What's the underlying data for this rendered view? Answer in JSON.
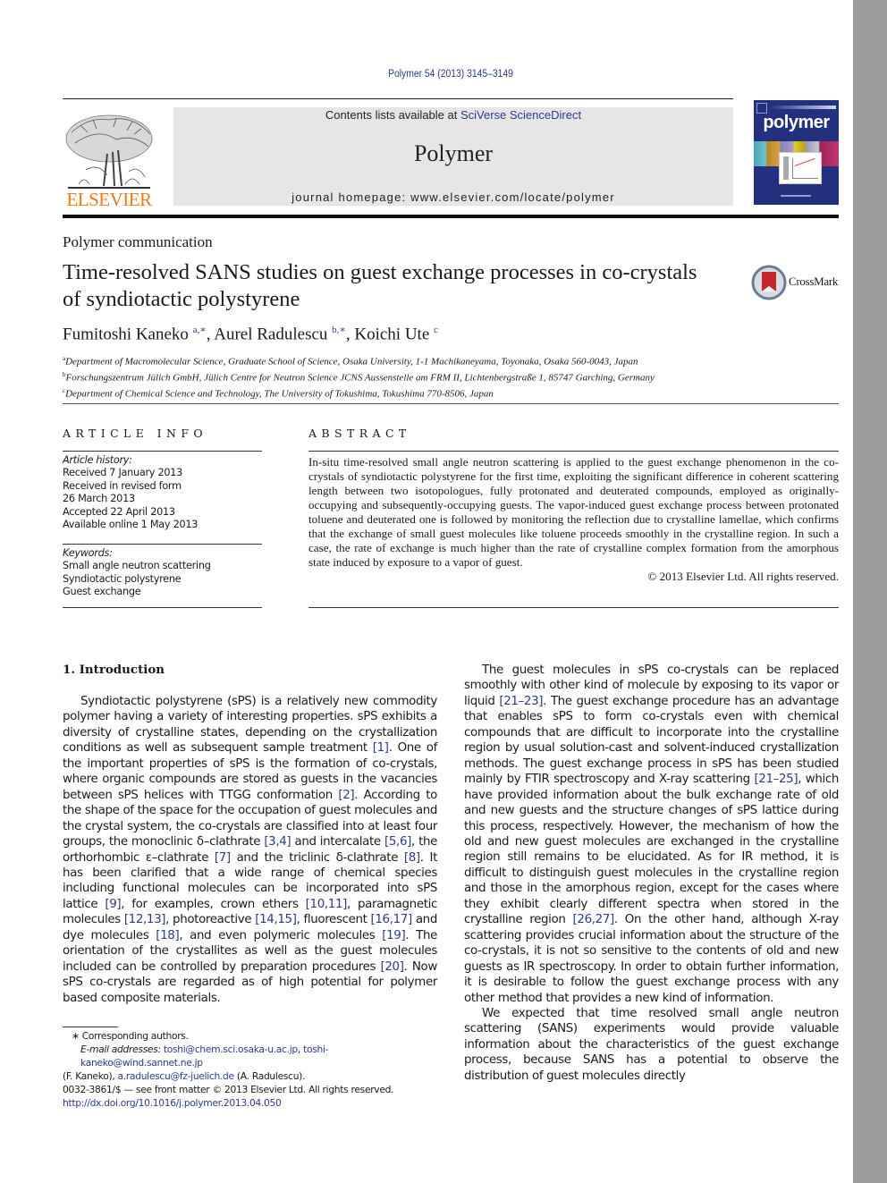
{
  "header": {
    "journal_ref": "Polymer 54 (2013) 3145–3149",
    "contents_prefix": "Contents lists available at ",
    "contents_link": "SciVerse ScienceDirect",
    "journal_name": "Polymer",
    "homepage": "journal homepage: www.elsevier.com/locate/polymer",
    "publisher_logo_text": "ELSEVIER",
    "cover_title": "polymer"
  },
  "article": {
    "type": "Polymer communication",
    "title": "Time-resolved SANS studies on guest exchange processes in co-crystals of syndiotactic polystyrene",
    "crossmark_label": "CrossMark",
    "authors": [
      {
        "name": "Fumitoshi Kaneko",
        "sup": "a,∗"
      },
      {
        "name": "Aurel Radulescu",
        "sup": "b,∗"
      },
      {
        "name": "Koichi Ute",
        "sup": "c"
      }
    ],
    "affiliations": [
      {
        "key": "a",
        "text": "Department of Macromolecular Science, Graduate School of Science, Osaka University, 1-1 Machikaneyama, Toyonaka, Osaka 560-0043, Japan"
      },
      {
        "key": "b",
        "text": "Forschungszentrum Jülich GmbH, Jülich Centre for Neutron Science JCNS Aussenstelle am FRM II, Lichtenbergstraße 1, 85747 Garching, Germany"
      },
      {
        "key": "c",
        "text": "Department of Chemical Science and Technology, The University of Tokushima, Tokushima 770-8506, Japan"
      }
    ]
  },
  "article_info": {
    "heading": "ARTICLE INFO",
    "history_label": "Article history:",
    "history": [
      "Received 7 January 2013",
      "Received in revised form",
      "26 March 2013",
      "Accepted 22 April 2013",
      "Available online 1 May 2013"
    ],
    "keywords_label": "Keywords:",
    "keywords": [
      "Small angle neutron scattering",
      "Syndiotactic polystyrene",
      "Guest exchange"
    ]
  },
  "abstract": {
    "heading": "ABSTRACT",
    "text": "In-situ time-resolved small angle neutron scattering is applied to the guest exchange phenomenon in the co-crystals of syndiotactic polystyrene for the first time, exploiting the significant difference in coherent scattering length between two isotopologues, fully protonated and deuterated compounds, employed as originally-occupying and subsequently-occupying guests. The vapor-induced guest exchange process between protonated toluene and deuterated one is followed by monitoring the reflection due to crys­talline lamellae, which confirms that the exchange of small guest molecules like toluene proceeds smoothly in the crystalline region. In such a case, the rate of exchange is much higher than the rate of crystalline complex formation from the amorphous state induced by exposure to a vapor of guest.",
    "copyright": "© 2013 Elsevier Ltd. All rights reserved."
  },
  "body": {
    "section_heading": "1.  Introduction",
    "left_paragraph": [
      {
        "t": "Syndiotactic polystyrene (sPS) is a relatively new commodity polymer having a variety of interesting properties. sPS exhibits a diversity of crystalline states, depending on the crystallization conditions as well as subsequent sample treatment "
      },
      {
        "ref": "[1]"
      },
      {
        "t": ". One of the important properties of sPS is the formation of co-crystals, where organic compounds are stored as guests in the vacancies between sPS helices with TTGG conformation "
      },
      {
        "ref": "[2]"
      },
      {
        "t": ". According to the shape of the space for the occupation of guest molecules and the crystal system, the co-crystals are classified into at least four groups, the monoclinic δ–clathrate "
      },
      {
        "ref": "[3,4]"
      },
      {
        "t": " and intercalate "
      },
      {
        "ref": "[5,6]"
      },
      {
        "t": ", the ortho­rhombic ε–clathrate "
      },
      {
        "ref": "[7]"
      },
      {
        "t": " and the triclinic δ-clathrate "
      },
      {
        "ref": "[8]"
      },
      {
        "t": ". It has been clarified that a wide range of chemical species including functional molecules can be incorporated into sPS lattice "
      },
      {
        "ref": "[9]"
      },
      {
        "t": ", for examples, crown ethers "
      },
      {
        "ref": "[10,11]"
      },
      {
        "t": ", paramagnetic molecules "
      },
      {
        "ref": "[12,13]"
      },
      {
        "t": ", photo­reactive "
      },
      {
        "ref": "[14,15]"
      },
      {
        "t": ", fluorescent "
      },
      {
        "ref": "[16,17]"
      },
      {
        "t": " and dye molecules "
      },
      {
        "ref": "[18]"
      },
      {
        "t": ", and even polymeric molecules "
      },
      {
        "ref": "[19]"
      },
      {
        "t": ". The orientation of the crystallites as well as the guest molecules included can be controlled by prepa­ration procedures "
      },
      {
        "ref": "[20]"
      },
      {
        "t": ". Now sPS co-crystals are regarded as of high potential for polymer based composite materials."
      }
    ],
    "right_paragraph_1": [
      {
        "t": "The guest molecules in sPS co-crystals can be replaced smoothly with other kind of molecule by exposing to its vapor or liquid "
      },
      {
        "ref": "[21–23]"
      },
      {
        "t": ". The guest exchange procedure has an advantage that enables sPS to form co-crystals even with chemical compounds that are difficult to incorporate into the crystalline region by usual solution-cast and solvent-induced crystallization methods. The guest ex­change process in sPS has been studied mainly by FTIR spectros­copy and X-ray scattering "
      },
      {
        "ref": "[21–25]"
      },
      {
        "t": ", which have provided information about the bulk exchange rate of old and new guests and the structure changes of sPS lattice during this process, respectively. However, the mechanism of how the old and new guest molecules are exchanged in the crystalline region still re­mains to be elucidated. As for IR method, it is difficult to distinguish guest molecules in the crystalline region and those in the amor­phous region, except for the cases where they exhibit clearly different spectra when stored in the crystalline region "
      },
      {
        "ref": "[26,27]"
      },
      {
        "t": ". On the other hand, although X-ray scattering provides crucial infor­mation about the structure of the co-crystals, it is not so sensitive to the contents of old and new guests as IR spectroscopy. In order to obtain further information, it is desirable to follow the guest exchange process with any other method that provides a new kind of information."
      }
    ],
    "right_paragraph_2": [
      {
        "t": "We expected that time resolved small angle neutron scattering (SANS) experiments would provide valuable information about the characteristics of the guest exchange process, because SANS has a potential to observe the distribution of guest molecules directly"
      }
    ]
  },
  "footnotes": {
    "corresponding": "∗  Corresponding authors.",
    "email_label": "E-mail addresses:",
    "emails": [
      "toshi@chem.sci.osaka-u.ac.jp",
      "toshi-kaneko@wind.sannet.ne.jp",
      "a.radulescu@fz-juelich.de"
    ],
    "kaneko_note": "(F. Kaneko), ",
    "radulescu_note": " (A. Radulescu).",
    "issn_line": "0032-3861/$ — see front matter © 2013 Elsevier Ltd. All rights reserved.",
    "doi": "http://dx.doi.org/10.1016/j.polymer.2013.04.050"
  },
  "colors": {
    "link": "#2b3a8c",
    "elsevier_orange": "#f07a1a",
    "header_box": "#e6e6e6",
    "cover_blue": "#22307e",
    "scrollbar": "#9b9b9b"
  }
}
